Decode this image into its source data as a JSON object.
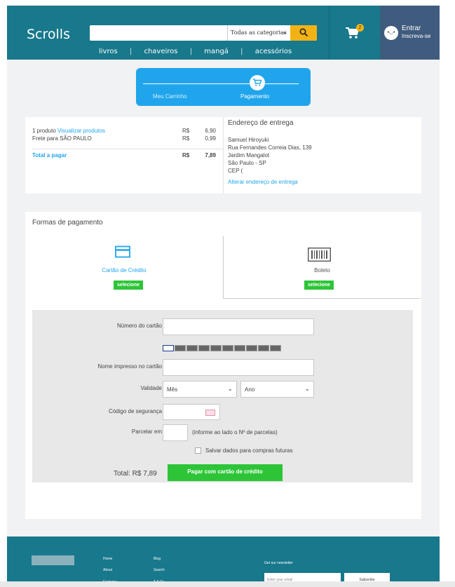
{
  "header": {
    "logo": "Scrolls",
    "search_placeholder": "",
    "category": "Todas as categorias",
    "nav": [
      "livros",
      "chaveiros",
      "mangá",
      "acessórios"
    ],
    "cart_count": "2",
    "login": "Entrar",
    "signup": "Inscreva-se"
  },
  "steps": {
    "step1": "Meu Carrinho",
    "step2": "Pagamento"
  },
  "summary": {
    "products": "1 produto",
    "view_products": "Visualizar produtos",
    "freight": "Frete para SÃO PAULO",
    "currency": "R$",
    "products_value": "6,90",
    "freight_value": "0,99",
    "total_label": "Total a pagar",
    "total_value": "7,89"
  },
  "address": {
    "title": "Endereço de entrega",
    "name": "Samuel Hiroyuki",
    "street": "Rua Fernandes Correia Dias, 139",
    "district": "Jardim Mangalot",
    "city": "São Paulo - SP",
    "cep": "CEP (",
    "change": "Alterar endereço de entrega"
  },
  "payment": {
    "title": "Formas de pagamento",
    "credit_label": "Cartão de Crédito",
    "boleto_label": "Boleto",
    "select": "selecione",
    "card_number_label": "Número do cartão",
    "name_label": "Nome impresso no cartão",
    "validity_label": "Validade",
    "month": "Mês",
    "year": "Ano",
    "cvv_label": "Código de segurança",
    "installments_label": "Parcelar em",
    "installments_note": "(informe ao lado o Nº de parcelas)",
    "save_label": "Salvar dados para compras futuras",
    "total": "Total: R$ 7,89",
    "pay_button": "Pagar com cartão de crédito"
  },
  "footer": {
    "links_col1": [
      "Home",
      "About",
      "Features"
    ],
    "links_col2": [
      "Blog",
      "Search",
      "T & Cs"
    ],
    "newsletter_label": "Get our newsletter",
    "email_placeholder": "Enter your email",
    "subscribe": "Subscribe"
  },
  "colors": {
    "header": "#18788c",
    "accent": "#20a5ec",
    "green": "#2dc537",
    "search_button": "#f2b216",
    "user_panel": "#3f5b7e"
  }
}
